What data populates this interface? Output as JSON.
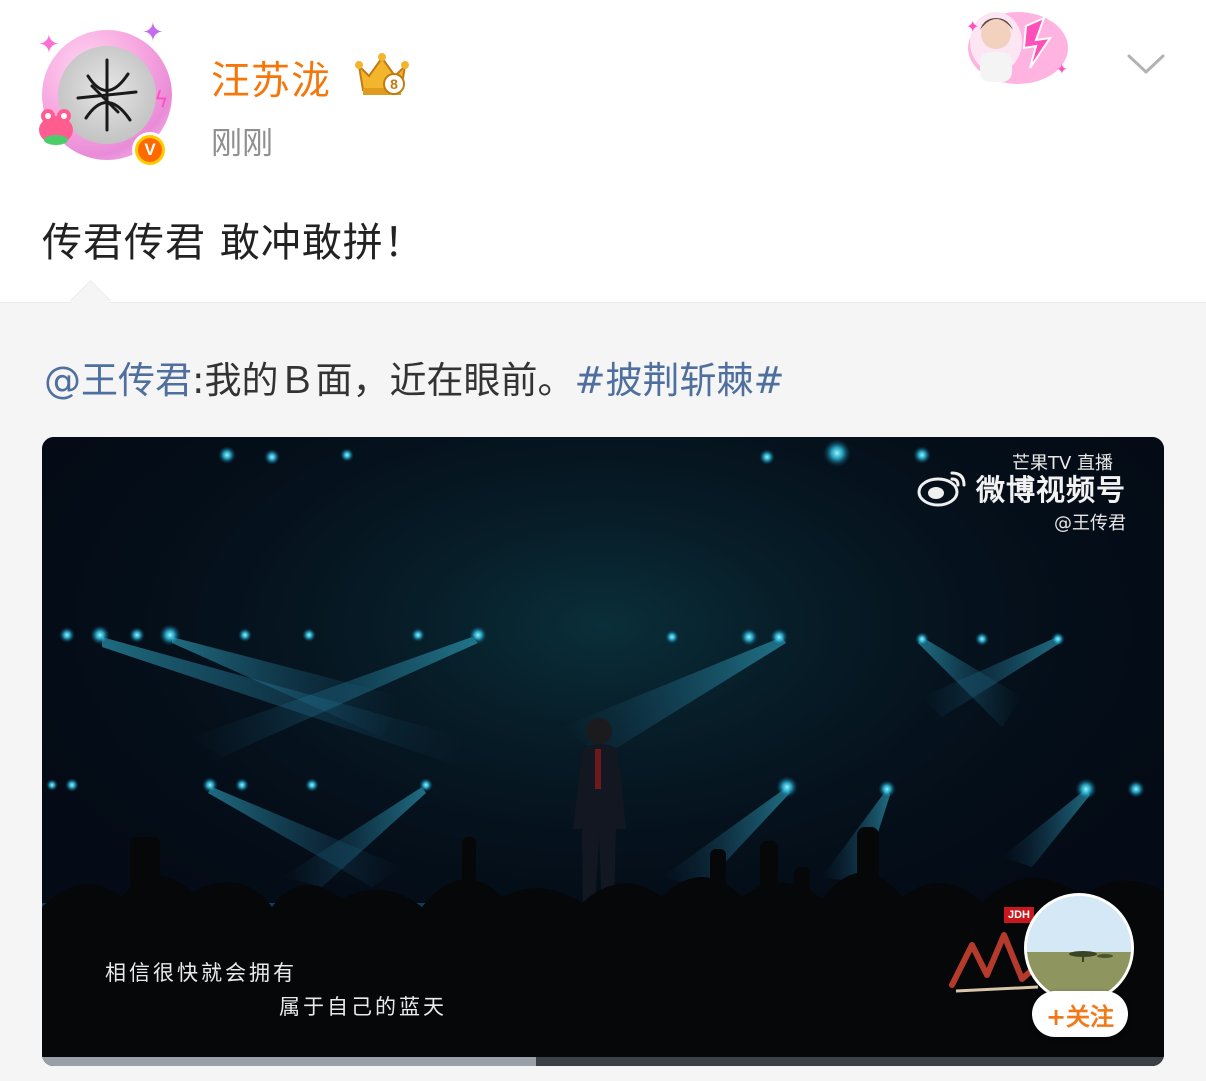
{
  "post": {
    "username": "汪苏泷",
    "timestamp": "刚刚",
    "text": "传君传君 敢冲敢拼！",
    "verified_mark": "V",
    "crown_level": "8"
  },
  "repost": {
    "mention": "@王传君",
    "body": ":我的Ｂ面，近在眼前。",
    "hashtag": "#披荆斩棘#"
  },
  "video": {
    "watermark": "微博视频号",
    "broadcaster_mark": "芒果TV 直播",
    "uploader": "@王传君",
    "subtitles": [
      "相信很快就会拥有",
      "属于自己的蓝天"
    ],
    "sponsor_tag": "JDH",
    "progress": 0.44
  },
  "follow": {
    "label": "+关注"
  },
  "colors": {
    "username": "#f5770b",
    "link": "#4f6f9f",
    "follow": "#f07a1a"
  },
  "icons": [
    "crown-icon",
    "verified-icon",
    "chevron-down-icon",
    "weibo-logo-icon"
  ]
}
